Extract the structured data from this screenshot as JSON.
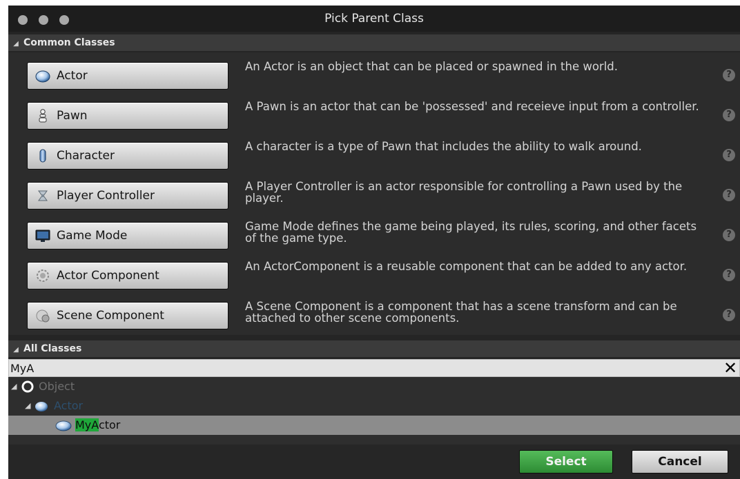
{
  "window": {
    "title": "Pick Parent Class"
  },
  "common_section": {
    "label": "Common Classes"
  },
  "common_classes": [
    {
      "name": "Actor",
      "icon": "actor-sphere-icon",
      "description": "An Actor is an object that can be placed or spawned in the world."
    },
    {
      "name": "Pawn",
      "icon": "pawn-icon",
      "description": "A Pawn is an actor that can be 'possessed' and receieve input from a controller."
    },
    {
      "name": "Character",
      "icon": "character-capsule-icon",
      "description": "A character is a type of Pawn that includes the ability to walk around."
    },
    {
      "name": "Player Controller",
      "icon": "player-controller-icon",
      "description": "A Player Controller is an actor responsible for controlling a Pawn used by the player."
    },
    {
      "name": "Game Mode",
      "icon": "game-mode-monitor-icon",
      "description": "Game Mode defines the game being played, its rules, scoring, and other facets of the game type."
    },
    {
      "name": "Actor Component",
      "icon": "actor-component-gear-icon",
      "description": "An ActorComponent is a reusable component that can be added to any actor."
    },
    {
      "name": "Scene Component",
      "icon": "scene-component-icon",
      "description": "A Scene Component is a component that has a scene transform and can be attached to other scene components."
    }
  ],
  "all_section": {
    "label": "All Classes"
  },
  "search": {
    "value": "MyA",
    "clear_label": "✕"
  },
  "tree": {
    "object": {
      "label": "Object"
    },
    "actor": {
      "label": "Actor"
    },
    "my_actor": {
      "match": "MyA",
      "rest": "ctor"
    }
  },
  "buttons": {
    "select": "Select",
    "cancel": "Cancel"
  },
  "colors": {
    "select_green": "#3fa447",
    "highlight_green": "#1fa83a",
    "selected_row": "#8c8c8c"
  }
}
